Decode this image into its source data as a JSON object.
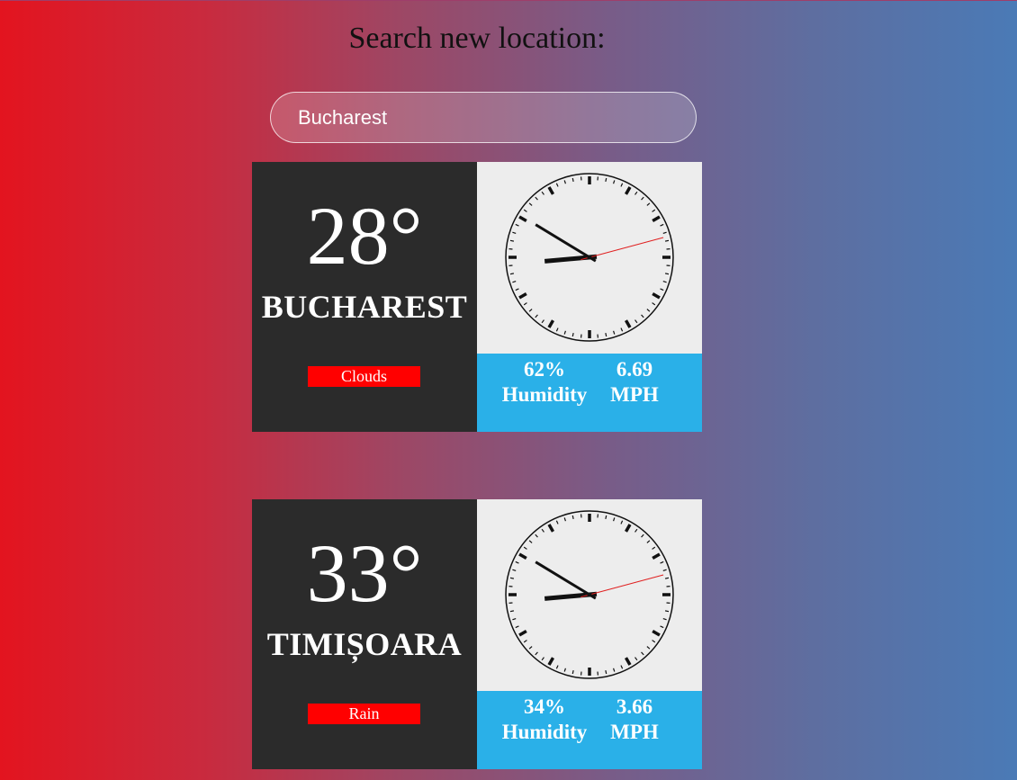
{
  "heading": "Search new location:",
  "search": {
    "value": "Bucharest",
    "placeholder": ""
  },
  "cards": [
    {
      "temperature": "28°",
      "city": "BUCHAREST",
      "condition": "Clouds",
      "humidity_value": "62%",
      "humidity_label": "Humidity",
      "wind_value": "6.69",
      "wind_label": "MPH",
      "clock": {
        "hour": 8,
        "minute": 50,
        "second": 12.5
      }
    },
    {
      "temperature": "33°",
      "city": "TIMIȘOARA",
      "condition": "Rain",
      "humidity_value": "34%",
      "humidity_label": "Humidity",
      "wind_value": "3.66",
      "wind_label": "MPH",
      "clock": {
        "hour": 8,
        "minute": 50,
        "second": 12.5
      }
    }
  ],
  "colors": {
    "card_dark": "#2b2b2b",
    "clock_bg": "#ededed",
    "stats_bg": "#2ab0e8",
    "condition_bg": "#ff0000",
    "second_hand": "#e02020"
  }
}
